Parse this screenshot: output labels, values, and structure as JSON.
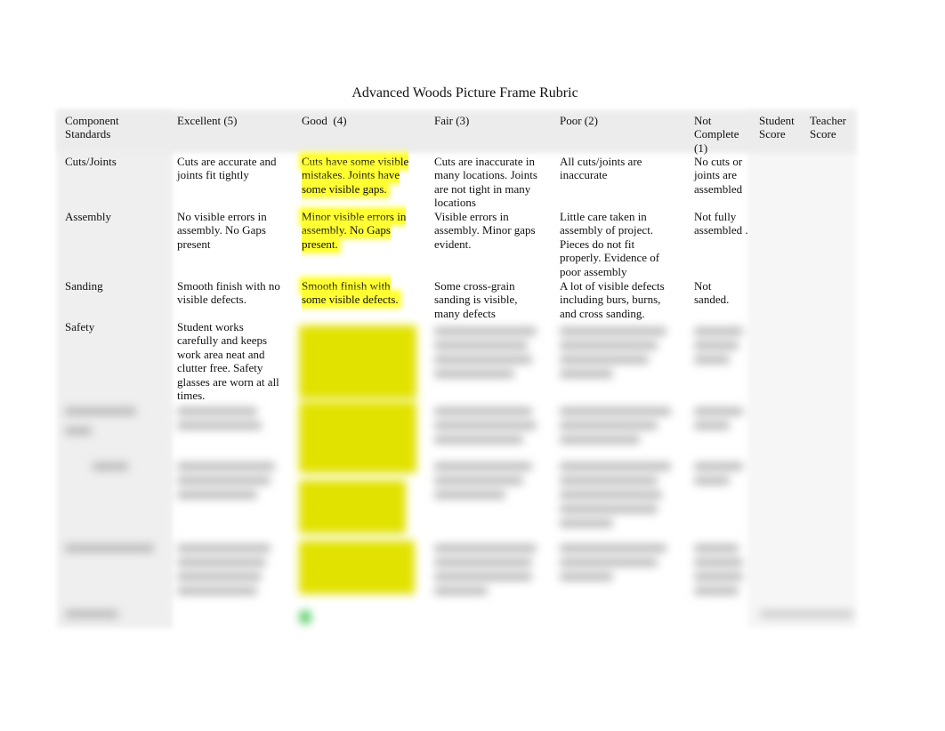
{
  "title": "Advanced Woods Picture Frame Rubric",
  "headers": [
    "Component Standards",
    "Excellent (5)",
    "Good  (4)",
    "Fair (3)",
    "Poor (2)",
    "Not Complete (1)",
    "Student Score",
    "Teacher Score"
  ],
  "rows": [
    {
      "component": "Cuts/Joints",
      "excellent": "Cuts are accurate and joints fit tightly",
      "good": "Cuts have some visible mistakes. Joints have some visible gaps.",
      "fair": "Cuts are inaccurate in many locations. Joints are not tight in many locations",
      "poor": "All cuts/joints are inaccurate",
      "not_complete": "No cuts or joints are assembled"
    },
    {
      "component": "Assembly",
      "excellent": "No visible errors in assembly. No Gaps present",
      "good": "Minor visible errors in assembly. No Gaps present.",
      "fair": "Visible errors in assembly. Minor gaps evident.",
      "poor": "Little care taken in assembly of project. Pieces do not fit properly. Evidence of poor assembly",
      "not_complete": "Not fully assembled ."
    },
    {
      "component": "Sanding",
      "excellent": "Smooth finish with no visible defects.",
      "good": "Smooth finish with some visible defects.",
      "fair": "Some cross-grain sanding is visible, many defects",
      "poor": "A lot of visible defects including burs, burns, and cross sanding.",
      "not_complete": "Not sanded."
    },
    {
      "component": "Safety",
      "excellent": "Student works carefully and keeps work area neat and clutter free. Safety glasses are worn at all times."
    }
  ],
  "colors": {
    "highlight": "#ffff33",
    "header_bg": "#ececec",
    "total_marker": "#5ccf6a"
  }
}
